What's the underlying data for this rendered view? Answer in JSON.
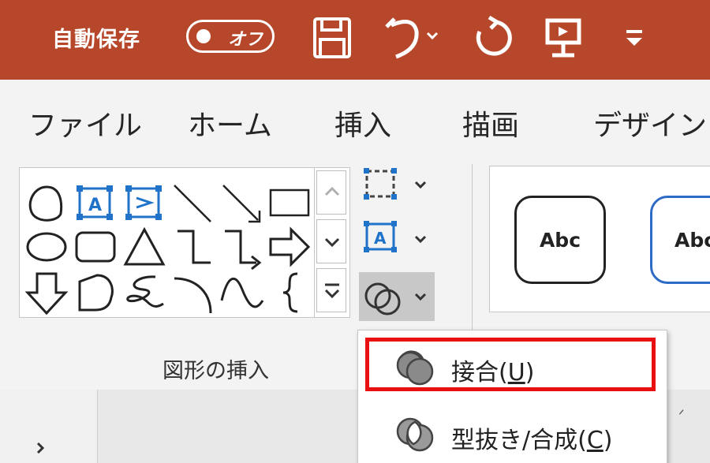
{
  "titlebar": {
    "autosave_label": "自動保存",
    "autosave_state": "オフ",
    "accent": "#b7472a"
  },
  "tabs": [
    "ファイル",
    "ホーム",
    "挿入",
    "描画",
    "デザイン"
  ],
  "shapes_group": {
    "label": "図形の挿入",
    "shapes": [
      "teardrop-shape-icon",
      "text-box-icon",
      "vertical-text-box-icon",
      "line-icon",
      "line-arrow-icon",
      "rectangle-icon",
      "oval-icon",
      "rounded-rectangle-icon",
      "triangle-icon",
      "elbow-connector-icon",
      "elbow-arrow-connector-icon",
      "right-arrow-icon",
      "down-arrow-icon",
      "flowchart-shape-icon",
      "freeform-scribble-icon",
      "arc-icon",
      "curve-icon",
      "left-brace-icon"
    ]
  },
  "style_samples": [
    "Abc",
    "Abc"
  ],
  "merge_menu": {
    "items": [
      {
        "label": "接合(",
        "key": "U",
        "close": ")"
      },
      {
        "label": "型抜き/合成(",
        "key": "C",
        "close": ")"
      }
    ],
    "highlight_color": "#e81010"
  }
}
